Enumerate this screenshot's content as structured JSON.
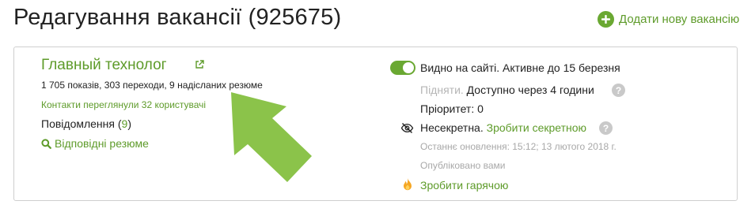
{
  "header": {
    "title": "Редагування вакансії (925675)",
    "add_vacancy": "Додати нову вакансію"
  },
  "vacancy": {
    "title": "Главный технолог",
    "stats": "1 705 показів, 303 переходи, 9 надісланих резюме",
    "contacts_viewed": "Контакти переглянули 32 користувачі",
    "messages_label": "Повідомлення (",
    "messages_count": "9",
    "messages_close": ")",
    "matching_resumes": "Відповідні резюме"
  },
  "status": {
    "visible": "Видно на сайті. Активне до 15 березня",
    "raise": "Підняти.",
    "raise_available": " Доступно через 4 години",
    "priority": "Пріоритет: 0",
    "secret_status": "Несекретна.",
    "make_secret": " Зробити секретною",
    "updated": "Останнє оновлення: 15:12; 13 лютого 2018 г.",
    "published": "Опубліковано вами",
    "make_hot": "Зробити гарячою",
    "help_mark": "?"
  },
  "colors": {
    "accent": "#5e9b2a",
    "arrow": "#8bc34a",
    "muted": "#a8a8a8",
    "hot": "#f5a623"
  },
  "icons": [
    "plus-circle-icon",
    "external-link-icon",
    "search-icon",
    "toggle-switch",
    "eye-off-icon",
    "fire-icon",
    "help-icon",
    "arrow-pointer"
  ]
}
